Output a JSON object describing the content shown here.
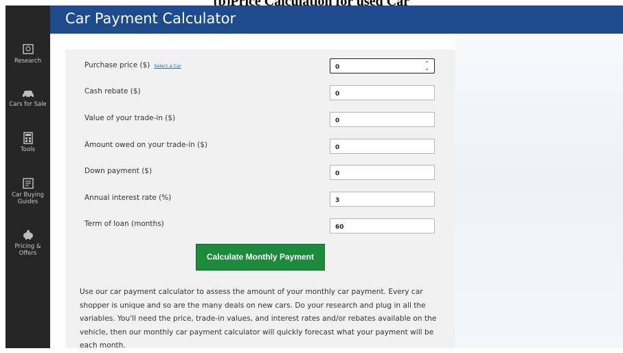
{
  "caption": "(b)Price Calculation for used Car",
  "sidebar": {
    "items": [
      {
        "label": "Research",
        "icon": "research-icon"
      },
      {
        "label": "Cars for Sale",
        "icon": "car-icon"
      },
      {
        "label": "Tools",
        "icon": "calculator-icon"
      },
      {
        "label": "Car Buying Guides",
        "icon": "guide-icon"
      },
      {
        "label": "Pricing & Offers",
        "icon": "piggy-bank-icon"
      }
    ]
  },
  "header": {
    "title": "Car Payment Calculator"
  },
  "form": {
    "purchase_price": {
      "label": "Purchase price ($)",
      "link": "Select a Car",
      "value": "0"
    },
    "cash_rebate": {
      "label": "Cash rebate ($)",
      "value": "0"
    },
    "trade_in_value": {
      "label": "Value of your trade-in ($)",
      "value": "0"
    },
    "amount_owed": {
      "label": "Amount owed on your trade-in ($)",
      "value": "0"
    },
    "down_payment": {
      "label": "Down payment ($)",
      "value": "0"
    },
    "interest_rate": {
      "label": "Annual interest rate (%)",
      "value": "3"
    },
    "loan_term": {
      "label": "Term of loan (months)",
      "value": "60"
    }
  },
  "calculate_button": "Calculate Monthly Payment",
  "description": "Use our car payment calculator to assess the amount of your monthly car payment. Every car shopper is unique and so are the many deals on new cars. Do your research and plug in all the variables. You'll need the price, trade-in values, and interest rates and/or rebates available on the vehicle, then our monthly car payment calculator will quickly forecast what your payment will be each month.",
  "colors": {
    "header": "#1d4b8c",
    "sidebar": "#262626",
    "button": "#1e8a3c"
  }
}
